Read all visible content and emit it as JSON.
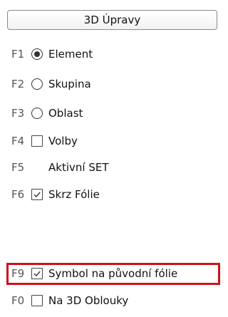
{
  "header": {
    "title": "3D Úpravy"
  },
  "options": [
    {
      "key": "F1",
      "control": "radio",
      "checked": true,
      "label": "Element"
    },
    {
      "key": "F2",
      "control": "radio",
      "checked": false,
      "label": "Skupina"
    },
    {
      "key": "F3",
      "control": "radio",
      "checked": false,
      "label": "Oblast"
    },
    {
      "key": "F4",
      "control": "checkbox",
      "checked": false,
      "label": "Volby"
    },
    {
      "key": "F5",
      "control": "none",
      "checked": false,
      "label": "Aktivní SET"
    },
    {
      "key": "F6",
      "control": "checkbox",
      "checked": true,
      "label": "Skrz Fólie"
    },
    {
      "key": "F9",
      "control": "checkbox",
      "checked": true,
      "label": "Symbol na původní fólie"
    },
    {
      "key": "F0",
      "control": "checkbox",
      "checked": false,
      "label": "Na 3D Oblouky"
    }
  ],
  "colors": {
    "highlight": "#d0101a"
  }
}
